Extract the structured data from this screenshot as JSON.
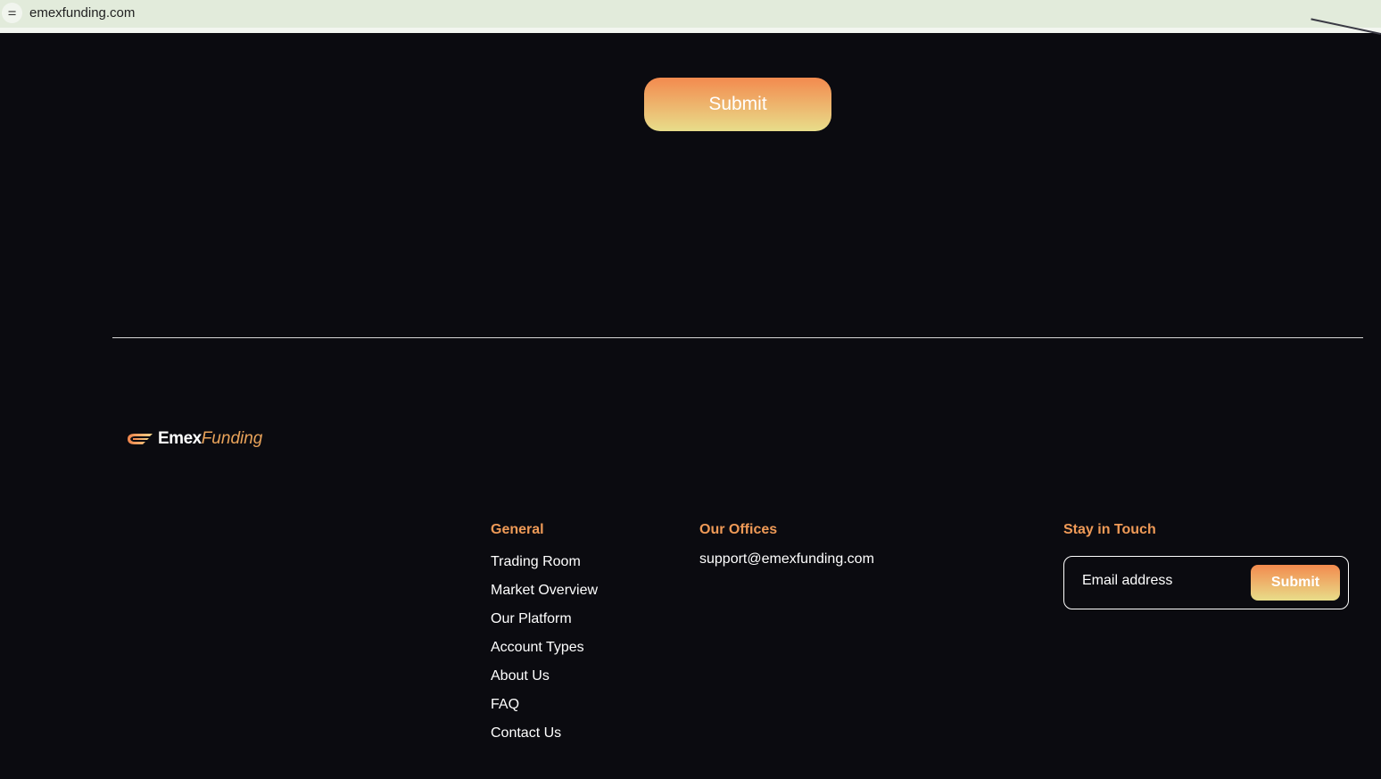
{
  "browser": {
    "url": "emexfunding.com",
    "site_info_icon": "tune-icon"
  },
  "form": {
    "submit_label": "Submit"
  },
  "logo": {
    "part1": "Emex",
    "part2": "Funding",
    "accent": "#e9a35a"
  },
  "footer": {
    "general": {
      "heading": "General",
      "links": [
        "Trading Room",
        "Market Overview",
        "Our Platform",
        "Account Types",
        "About Us",
        "FAQ",
        "Contact Us"
      ]
    },
    "offices": {
      "heading": "Our Offices",
      "email": "support@emexfunding.com"
    },
    "newsletter": {
      "heading": "Stay in Touch",
      "placeholder": "Email address",
      "submit_label": "Submit"
    }
  },
  "colors": {
    "background": "#0b0b10",
    "accent": "#ef9a57",
    "gradient_top": "#f38a4e",
    "gradient_bottom": "#e8dd8a"
  }
}
